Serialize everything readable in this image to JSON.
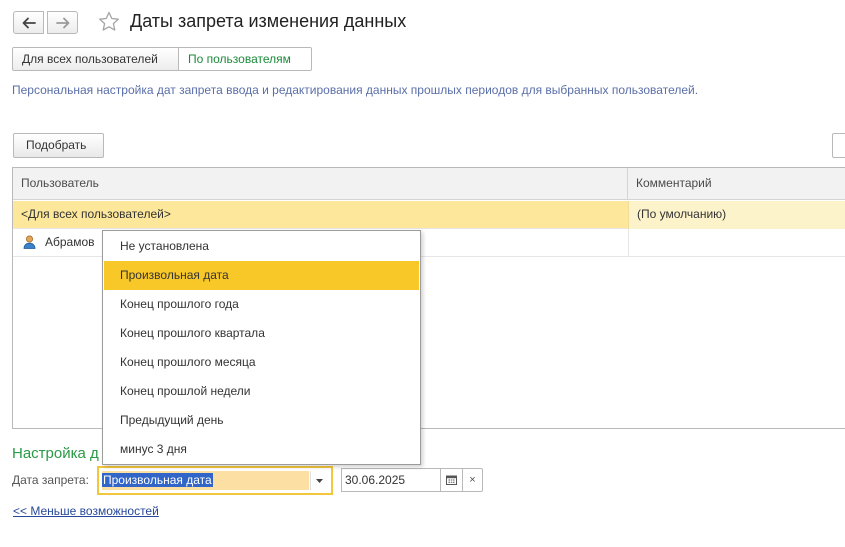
{
  "header": {
    "title": "Даты запрета изменения данных",
    "icons": {
      "back": "arrow-left-icon",
      "forward": "arrow-right-icon",
      "favorite": "star-icon"
    }
  },
  "mode_switch": {
    "all_users_label": "Для всех пользователей",
    "by_user_label": "По пользователям",
    "active": "by_user"
  },
  "description": "Персональная настройка дат запрета ввода и редактирования данных прошлых периодов для выбранных пользователей.",
  "toolbar": {
    "pick_label": "Подобрать"
  },
  "table": {
    "columns": [
      "Пользователь",
      "Комментарий"
    ],
    "rows": [
      {
        "user": "<Для всех пользователей>",
        "comment": "(По умолчанию)",
        "selected": true
      },
      {
        "user": "Абрамов",
        "comment": "",
        "selected": false
      }
    ]
  },
  "settings": {
    "title": "Настройка д",
    "prohibition_date_label": "Дата запрета:",
    "date_kind_value": "Произвольная дата",
    "date_value": "30.06.2025",
    "clear_glyph": "×"
  },
  "dropdown": {
    "options": [
      "Не установлена",
      "Произвольная дата",
      "Конец прошлого года",
      "Конец прошлого квартала",
      "Конец прошлого месяца",
      "Конец прошлой недели",
      "Предыдущий день",
      "минус 3 дня"
    ],
    "selected": "Произвольная дата"
  },
  "footer": {
    "less_options_link": "<< Меньше возможностей"
  },
  "colors": {
    "accent_green": "#2a9a46",
    "selection_yellow": "#f8c829",
    "row_highlight": "#fce79a",
    "link_blue": "#27489a"
  }
}
